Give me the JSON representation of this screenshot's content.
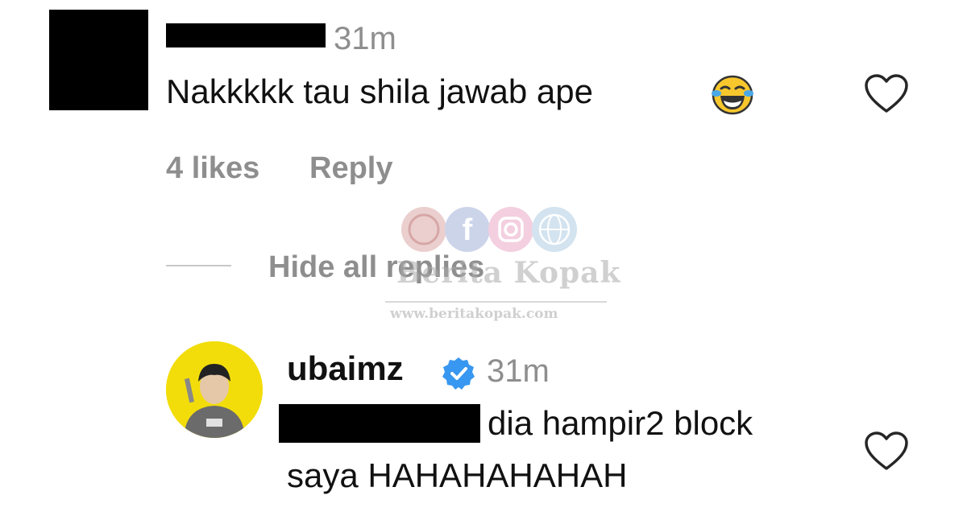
{
  "comment": {
    "timestamp": "31m",
    "text": "Nakkkkk tau shila jawab ape",
    "emoji_icon": "face-with-tears-of-joy-icon",
    "likes": "4 likes",
    "reply_label": "Reply"
  },
  "replies_toggle": {
    "label": "Hide all replies"
  },
  "watermark": {
    "title": "Berita Kopak",
    "url": "www.beritakopak.com"
  },
  "reply": {
    "username": "ubaimz",
    "verified": true,
    "timestamp": "31m",
    "text_line1": "dia hampir2 block",
    "text_line2": "saya HAHAHAHAHAH"
  },
  "colors": {
    "text": "#111111",
    "muted": "#8e8e8e",
    "verified": "#3897f0",
    "avatar_bg": "#f2dd0a"
  }
}
